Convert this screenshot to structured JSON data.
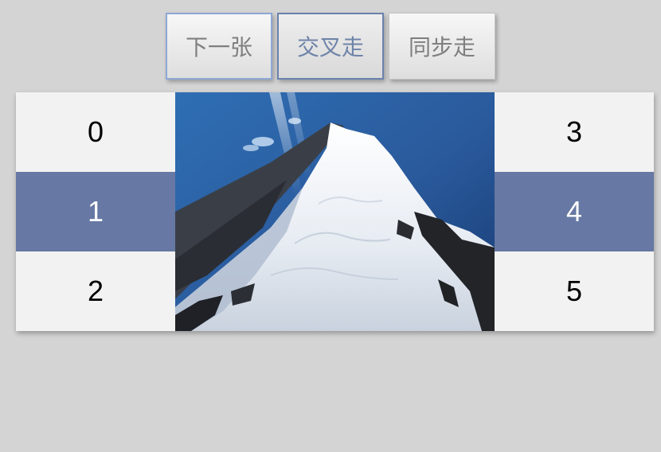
{
  "toolbar": {
    "next_label": "下一张",
    "cross_label": "交叉走",
    "sync_label": "同步走"
  },
  "carousel": {
    "left_items": [
      {
        "label": "0",
        "active": false
      },
      {
        "label": "1",
        "active": true
      },
      {
        "label": "2",
        "active": false
      }
    ],
    "right_items": [
      {
        "label": "3",
        "active": false
      },
      {
        "label": "4",
        "active": true
      },
      {
        "label": "5",
        "active": false
      }
    ],
    "image": {
      "subject": "snow-covered mountain peak"
    }
  },
  "colors": {
    "background": "#d4d4d4",
    "active_cell": "#6678a3",
    "inactive_cell": "#f2f2f2"
  }
}
